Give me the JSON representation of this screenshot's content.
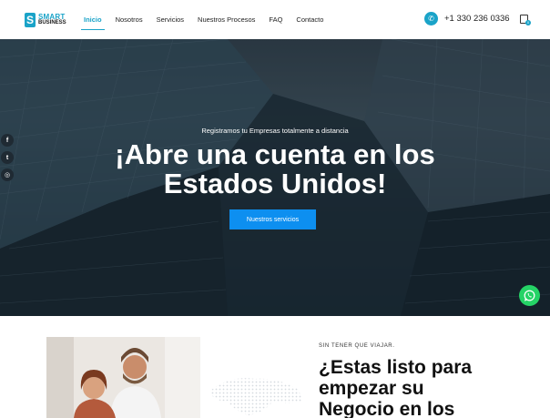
{
  "brand": {
    "line1": "SMART",
    "line2": "BUSINESS"
  },
  "nav": {
    "items": [
      {
        "label": "Inicio",
        "active": true
      },
      {
        "label": "Nosotros"
      },
      {
        "label": "Servicios"
      },
      {
        "label": "Nuestros Procesos"
      },
      {
        "label": "FAQ"
      },
      {
        "label": "Contacto"
      }
    ]
  },
  "contact": {
    "phone": "+1 330 236 0336",
    "phone_icon": "phone-icon"
  },
  "cart": {
    "icon": "shopping-bag-icon",
    "count": "0"
  },
  "hero": {
    "subtitle": "Registramos tu Empresas totalmente a distancia",
    "title_line1": "¡Abre una cuenta en los",
    "title_line2": "Estados Unidos!",
    "button_label": "Nuestros servicios"
  },
  "social": {
    "items": [
      {
        "icon": "facebook-icon",
        "glyph": "f"
      },
      {
        "icon": "twitter-icon",
        "glyph": "t"
      },
      {
        "icon": "instagram-icon",
        "glyph": "◎"
      }
    ]
  },
  "whatsapp": {
    "icon": "whatsapp-icon"
  },
  "section": {
    "kicker": "SIN TENER QUE VIAJAR.",
    "title_line1": "¿Estas listo para",
    "title_line2": "empezar su",
    "title_line3": "Negocio en los"
  },
  "colors": {
    "accent": "#1aa3c8",
    "button": "#0d8ff0",
    "whatsapp": "#25d366"
  }
}
